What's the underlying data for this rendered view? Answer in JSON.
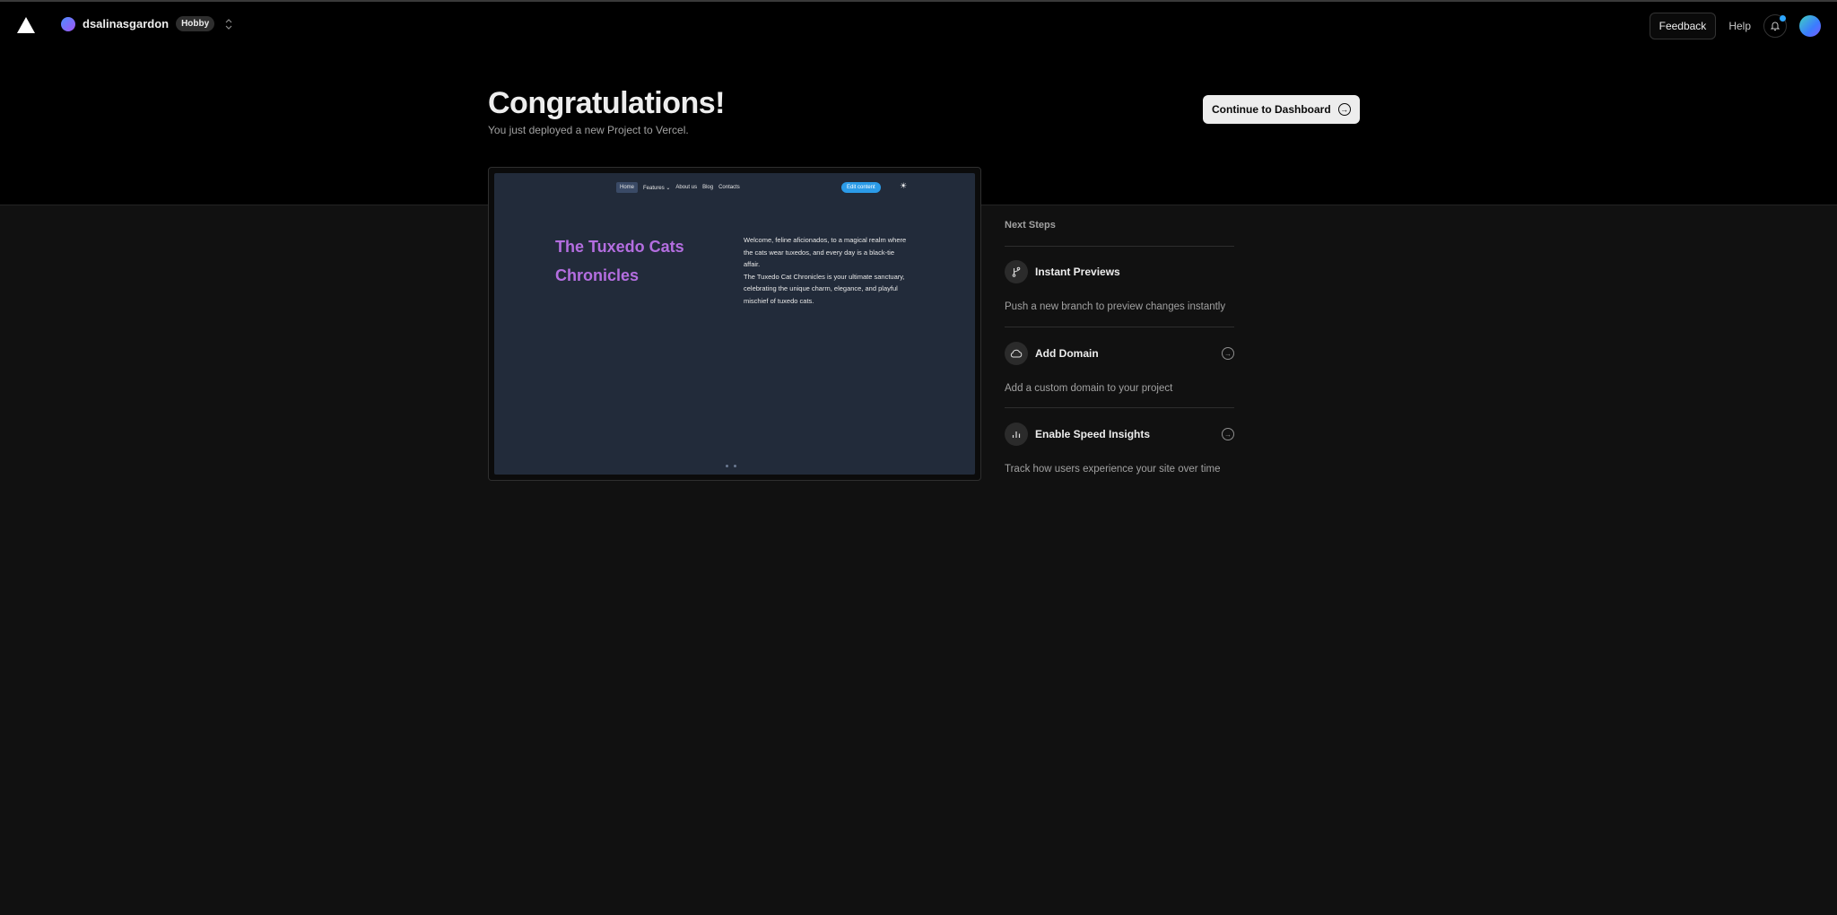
{
  "nav": {
    "team_name": "dsalinasgardon",
    "plan_badge": "Hobby",
    "feedback_label": "Feedback",
    "help_label": "Help"
  },
  "hero": {
    "title": "Congratulations!",
    "subtitle": "You just deployed a new Project to Vercel.",
    "continue_label": "Continue to Dashboard"
  },
  "preview": {
    "nav_items": [
      "Home",
      "Features ⌄",
      "About us",
      "Blog",
      "Contacts"
    ],
    "edit_label": "Edit content",
    "title": "The Tuxedo Cats Chronicles",
    "paragraph_1": "Welcome, feline aficionados, to a magical realm where the cats wear tuxedos, and every day is a black-tie affair.",
    "paragraph_2": "The Tuxedo Cat Chronicles is your ultimate sanctuary, celebrating the unique charm, elegance, and playful mischief of tuxedo cats."
  },
  "next_steps": {
    "heading": "Next Steps",
    "items": [
      {
        "label": "Instant Previews",
        "description": "Push a new branch to preview changes instantly",
        "icon": "git-branch-icon",
        "has_arrow": false
      },
      {
        "label": "Add Domain",
        "description": "Add a custom domain to your project",
        "icon": "cloud-icon",
        "has_arrow": true
      },
      {
        "label": "Enable Speed Insights",
        "description": "Track how users experience your site over time",
        "icon": "bar-chart-icon",
        "has_arrow": true
      }
    ]
  },
  "colors": {
    "accent_blue": "#2ea6ff",
    "preview_title": "#b46ee0",
    "background": "#111111"
  }
}
